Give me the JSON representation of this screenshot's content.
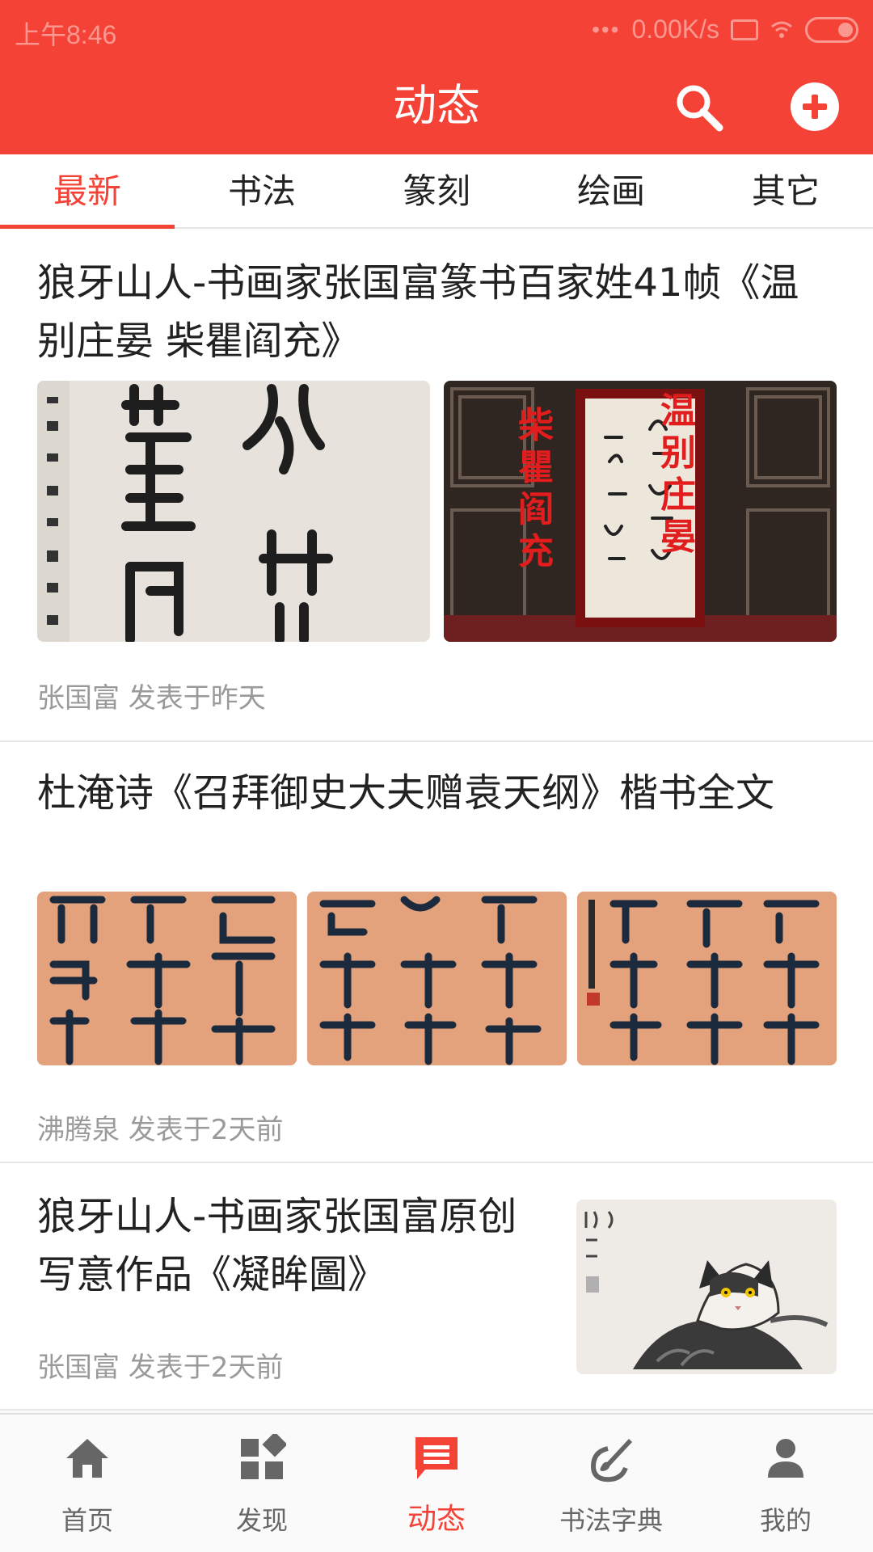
{
  "status_bar": {
    "time": "上午8:46",
    "speed": "0.00K/s"
  },
  "header": {
    "title": "动态",
    "search_icon": "search-icon",
    "add_icon": "add-circle-icon",
    "accent": "#f44336"
  },
  "tabs": [
    {
      "label": "最新",
      "active": true
    },
    {
      "label": "书法",
      "active": false
    },
    {
      "label": "篆刻",
      "active": false
    },
    {
      "label": "绘画",
      "active": false
    },
    {
      "label": "其它",
      "active": false
    }
  ],
  "feed": [
    {
      "title": "狼牙山人-书画家张国富篆书百家姓41帧《温别庄晏 柴瞿阎充》",
      "meta": "张国富 发表于昨天",
      "image_text": {
        "left_red": "柴瞿阎充",
        "right_red": "温别庄晏"
      }
    },
    {
      "title": "杜淹诗《召拜御史大夫赠袁天纲》楷书全文",
      "meta": "沸腾泉 发表于2天前"
    },
    {
      "title": "狼牙山人-书画家张国富原创写意作品《凝眸圖》",
      "meta": "张国富 发表于2天前"
    }
  ],
  "bottom_nav": [
    {
      "label": "首页",
      "icon": "home-icon",
      "active": false
    },
    {
      "label": "发现",
      "icon": "discover-icon",
      "active": false
    },
    {
      "label": "动态",
      "icon": "message-icon",
      "active": true
    },
    {
      "label": "书法字典",
      "icon": "brush-icon",
      "active": false
    },
    {
      "label": "我的",
      "icon": "person-icon",
      "active": false
    }
  ]
}
